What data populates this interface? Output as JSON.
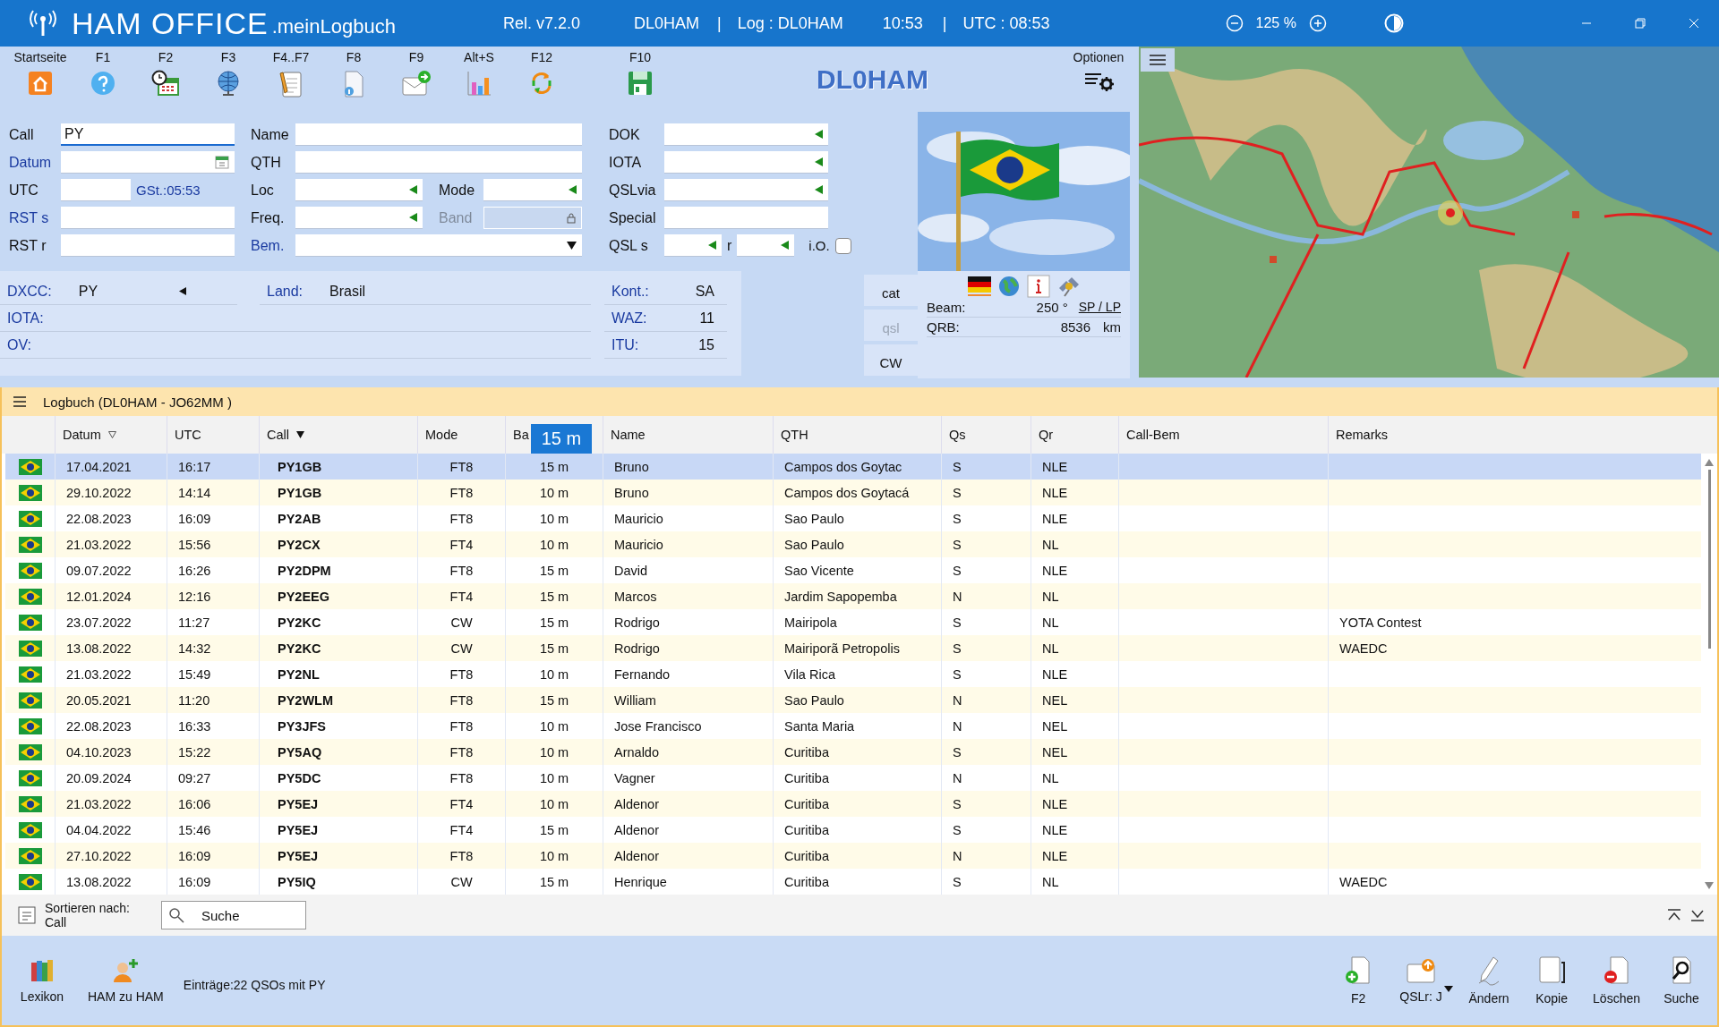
{
  "title_bar": {
    "app_name": "HAM OFFICE",
    "subtitle": ".meinLogbuch",
    "release": "Rel. v7.2.0",
    "station": "DL0HAM",
    "separator_1": "|",
    "log": "Log : DL0HAM",
    "time": "10:53",
    "separator_2": "|",
    "utc": "UTC : 08:53",
    "zoom": "125 %"
  },
  "toolbar": [
    {
      "key": "Startseite",
      "kind": "home"
    },
    {
      "key": "F1",
      "kind": "help"
    },
    {
      "key": "F2",
      "kind": "clock"
    },
    {
      "key": "F3",
      "kind": "globe"
    },
    {
      "key": "F4..F7",
      "kind": "notes"
    },
    {
      "key": "F8",
      "kind": "info"
    },
    {
      "key": "F9",
      "kind": "mail"
    },
    {
      "key": "Alt+S",
      "kind": "chart"
    },
    {
      "key": "F12",
      "kind": "sync"
    },
    {
      "key": "F10",
      "kind": "save"
    }
  ],
  "station_logo": "DL0HAM",
  "options": "Optionen",
  "form": {
    "call": {
      "label": "Call",
      "value": "PY",
      "link": false
    },
    "datum": {
      "label": "Datum",
      "kind": "date",
      "link": true
    },
    "utc": {
      "label": "UTC",
      "link": false
    },
    "gst": "GSt.:05:53",
    "rst_s": {
      "label": "RST s",
      "link": true
    },
    "rst_r": {
      "label": "RST r",
      "link": false
    },
    "name": {
      "label": "Name",
      "link": false
    },
    "qth": {
      "label": "QTH",
      "link": false
    },
    "loc": {
      "label": "Loc",
      "kind": "combo",
      "link": false
    },
    "mode": {
      "label": "Mode",
      "kind": "combo",
      "link": false
    },
    "freq": {
      "label": "Freq.",
      "kind": "combo",
      "link": false
    },
    "band": {
      "label": "Band",
      "kind": "locked",
      "link": false,
      "disabled": true
    },
    "bem": {
      "label": "Bem.",
      "kind": "select",
      "link": true
    },
    "dok": {
      "label": "DOK",
      "kind": "combo",
      "link": false
    },
    "iota": {
      "label": "IOTA",
      "kind": "combo",
      "link": false
    },
    "qslvia": {
      "label": "QSLvia",
      "kind": "combo",
      "link": false
    },
    "special": {
      "label": "Special",
      "link": false
    },
    "qsl_s": {
      "label": "QSL s",
      "kind": "combo",
      "link": false
    },
    "qsl_r": {
      "label": "r",
      "kind": "combo",
      "link": false
    },
    "io": {
      "label": "i.O.",
      "checked": false
    }
  },
  "info": {
    "dxcc_label": "DXCC:",
    "dxcc": "PY",
    "land_label": "Land:",
    "land": "Brasil",
    "kont_label": "Kont.:",
    "kont": "SA",
    "iota_label": "IOTA:",
    "waz_label": "WAZ:",
    "waz": "11",
    "ov_label": "OV:",
    "itu_label": "ITU:",
    "itu": "15"
  },
  "side_buttons": [
    {
      "label": "cat",
      "disabled": false
    },
    {
      "label": "qsl",
      "disabled": true
    },
    {
      "label": "CW",
      "disabled": false
    }
  ],
  "beam": {
    "beam_label": "Beam:",
    "beam_value": "250 °",
    "sp_lp": "SP / LP",
    "qrb_label": "QRB:",
    "qrb_value": "8536",
    "qrb_unit": "km"
  },
  "log": {
    "title": "Logbuch  (DL0HAM - JO62MM )",
    "tooltip": "15 m",
    "columns": [
      {
        "label": "Datum",
        "sorted": true,
        "primary": false
      },
      {
        "label": "UTC",
        "sorted": false
      },
      {
        "label": "Call",
        "sorted": true,
        "primary": true
      },
      {
        "label": "Mode",
        "sorted": false
      },
      {
        "label": "Ba",
        "sorted": false
      },
      {
        "label": "Name",
        "sorted": false
      },
      {
        "label": "QTH",
        "sorted": false
      },
      {
        "label": "Qs",
        "sorted": false
      },
      {
        "label": "Qr",
        "sorted": false
      },
      {
        "label": "Call-Bem",
        "sorted": false
      },
      {
        "label": "Remarks",
        "sorted": false
      }
    ],
    "rows": [
      {
        "date": "17.04.2021",
        "utc": "16:17",
        "call": "PY1GB",
        "mode": "FT8",
        "band": "15 m",
        "name": "Bruno",
        "qth": "Campos  dos Goytac",
        "qs": "S",
        "qr": "NLE",
        "selected": true
      },
      {
        "date": "29.10.2022",
        "utc": "14:14",
        "call": "PY1GB",
        "mode": "FT8",
        "band": "10 m",
        "name": "Bruno",
        "qth": "Campos dos Goytacá",
        "qs": "S",
        "qr": "NLE",
        "selected": false
      },
      {
        "date": "22.08.2023",
        "utc": "16:09",
        "call": "PY2AB",
        "mode": "FT8",
        "band": "10 m",
        "name": "Mauricio",
        "qth": "Sao Paulo",
        "qs": "S",
        "qr": "NLE",
        "selected": false
      },
      {
        "date": "21.03.2022",
        "utc": "15:56",
        "call": "PY2CX",
        "mode": "FT4",
        "band": "10 m",
        "name": "Mauricio",
        "qth": "Sao Paulo",
        "qs": "S",
        "qr": "NL",
        "selected": false
      },
      {
        "date": "09.07.2022",
        "utc": "16:26",
        "call": "PY2DPM",
        "mode": "FT8",
        "band": "15 m",
        "name": "David",
        "qth": "Sao Vicente",
        "qs": "S",
        "qr": "NLE",
        "selected": false
      },
      {
        "date": "12.01.2024",
        "utc": "12:16",
        "call": "PY2EEG",
        "mode": "FT4",
        "band": "15 m",
        "name": "Marcos",
        "qth": "Jardim  Sapopemba",
        "qs": "N",
        "qr": "NL",
        "selected": false
      },
      {
        "date": "23.07.2022",
        "utc": "11:27",
        "call": "PY2KC",
        "mode": "CW",
        "band": "15 m",
        "name": "Rodrigo",
        "qth": "Mairipola",
        "qs": "S",
        "qr": "NL",
        "remarks": "YOTA Contest",
        "selected": false
      },
      {
        "date": "13.08.2022",
        "utc": "14:32",
        "call": "PY2KC",
        "mode": "CW",
        "band": "15 m",
        "name": "Rodrigo",
        "qth": "Mairiporã Petropolis",
        "qs": "S",
        "qr": "NL",
        "remarks": "WAEDC",
        "selected": false
      },
      {
        "date": "21.03.2022",
        "utc": "15:49",
        "call": "PY2NL",
        "mode": "FT8",
        "band": "10 m",
        "name": "Fernando",
        "qth": "Vila Rica",
        "qs": "S",
        "qr": "NLE",
        "selected": false
      },
      {
        "date": "20.05.2021",
        "utc": "11:20",
        "call": "PY2WLM",
        "mode": "FT8",
        "band": "15 m",
        "name": "William",
        "qth": "Sao Paulo",
        "qs": "N",
        "qr": "NEL",
        "selected": false
      },
      {
        "date": "22.08.2023",
        "utc": "16:33",
        "call": "PY3JFS",
        "mode": "FT8",
        "band": "10 m",
        "name": "Jose Francisco",
        "qth": "Santa Maria",
        "qs": "N",
        "qr": "NEL",
        "selected": false
      },
      {
        "date": "04.10.2023",
        "utc": "15:22",
        "call": "PY5AQ",
        "mode": "FT8",
        "band": "10 m",
        "name": "Arnaldo",
        "qth": "Curitiba",
        "qs": "S",
        "qr": "NEL",
        "selected": false
      },
      {
        "date": "20.09.2024",
        "utc": "09:27",
        "call": "PY5DC",
        "mode": "FT8",
        "band": "10 m",
        "name": "Vagner",
        "qth": "Curitiba",
        "qs": "N",
        "qr": "NL",
        "selected": false
      },
      {
        "date": "21.03.2022",
        "utc": "16:06",
        "call": "PY5EJ",
        "mode": "FT4",
        "band": "10 m",
        "name": "Aldenor",
        "qth": "Curitiba",
        "qs": "S",
        "qr": "NLE",
        "selected": false
      },
      {
        "date": "04.04.2022",
        "utc": "15:46",
        "call": "PY5EJ",
        "mode": "FT4",
        "band": "15 m",
        "name": "Aldenor",
        "qth": "Curitiba",
        "qs": "S",
        "qr": "NLE",
        "selected": false
      },
      {
        "date": "27.10.2022",
        "utc": "16:09",
        "call": "PY5EJ",
        "mode": "FT8",
        "band": "10 m",
        "name": "Aldenor",
        "qth": "Curitiba",
        "qs": "N",
        "qr": "NLE",
        "selected": false
      },
      {
        "date": "13.08.2022",
        "utc": "16:09",
        "call": "PY5IQ",
        "mode": "CW",
        "band": "15 m",
        "name": "Henrique",
        "qth": "Curitiba",
        "qs": "S",
        "qr": "NL",
        "remarks": "WAEDC",
        "selected": false
      }
    ]
  },
  "sort_bar": {
    "label": "Sortieren nach:",
    "value": "Call",
    "search_placeholder": "Suche"
  },
  "bottom": {
    "left_buttons": [
      {
        "label": "Lexikon",
        "kind": "books"
      },
      {
        "label": "HAM zu HAM",
        "kind": "person"
      }
    ],
    "entries": "Einträge:22 QSOs mit PY",
    "right_buttons": [
      {
        "label": "F2",
        "kind": "new"
      },
      {
        "label": "QSLr: J",
        "kind": "qsl"
      },
      {
        "label": "Ändern",
        "kind": "edit"
      },
      {
        "label": "Kopie",
        "kind": "copy"
      },
      {
        "label": "Löschen",
        "kind": "delete"
      },
      {
        "label": "Suche",
        "kind": "search"
      }
    ]
  }
}
